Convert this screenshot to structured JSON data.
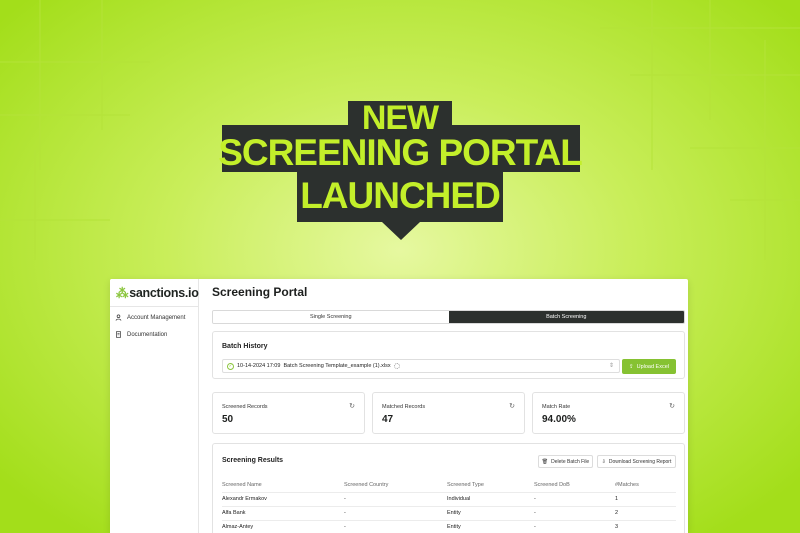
{
  "banner": {
    "line1": "NEW",
    "line2": "SCREENING PORTAL",
    "line3": "LAUNCHED"
  },
  "colors": {
    "accent": "#86c232",
    "banner_bg": "#2c302e",
    "banner_text": "#c3ef2a",
    "active_tab": "#2c302e"
  },
  "sidebar": {
    "logo": "sanctions.io",
    "items": [
      {
        "label": "Account Management",
        "icon": "user-icon"
      },
      {
        "label": "Documentation",
        "icon": "document-icon"
      }
    ]
  },
  "main": {
    "title": "Screening Portal",
    "tabs": [
      {
        "label": "Single Screening",
        "active": false
      },
      {
        "label": "Batch Screening",
        "active": true
      }
    ],
    "batch_history": {
      "title": "Batch History",
      "selected_date": "10-14-2024 17:09",
      "selected_file": "Batch Screening Template_example (1).xlsx",
      "upload_label": "Upload Excel"
    },
    "stats": [
      {
        "label": "Screened Records",
        "value": "50"
      },
      {
        "label": "Matched Records",
        "value": "47"
      },
      {
        "label": "Match Rate",
        "value": "94.00%"
      }
    ],
    "results": {
      "title": "Screening Results",
      "delete_label": "Delete Batch File",
      "download_label": "Download Screening Report",
      "columns": [
        "Screened Name",
        "Screened Country",
        "Screened Type",
        "Screened DoB",
        "#Matches"
      ],
      "rows": [
        [
          "Alexandr Ermakov",
          "-",
          "Individual",
          "-",
          "1"
        ],
        [
          "Alfa Bank",
          "-",
          "Entity",
          "-",
          "2"
        ],
        [
          "Almaz-Antey",
          "-",
          "Entity",
          "-",
          "3"
        ]
      ]
    }
  }
}
